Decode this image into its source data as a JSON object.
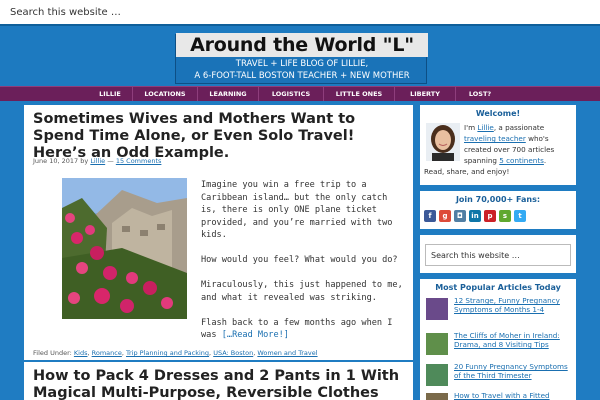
{
  "search": {
    "placeholder": "Search this website …"
  },
  "header": {
    "logo_title": "Around the World \"L\"",
    "tagline_1": "TRAVEL + LIFE BLOG OF LILLIE,",
    "tagline_2": "A 6-FOOT-TALL BOSTON TEACHER + NEW MOTHER"
  },
  "nav": {
    "items": [
      "LILLIE",
      "LOCATIONS",
      "LEARNING",
      "LOGISTICS",
      "LITTLE ONES",
      "LIBERTY",
      "LOST?"
    ]
  },
  "post": {
    "title": "Sometimes Wives and Mothers Want to Spend Time Alone, or Even Solo Travel! Here’s an Odd Example.",
    "date": "June 10, 2017",
    "by": "by",
    "author": "Lillie",
    "dash": "—",
    "comments": "15 Comments",
    "paragraphs": [
      "Imagine you win a free trip to a Caribbean island… but the only catch is, there is only ONE plane ticket provided, and you’re married with two kids.",
      "How would you feel? What would you do?",
      "Miraculously, this just happened to me, and what it revealed was striking.",
      "Flash back to a few months ago when I was"
    ],
    "read_more": "[…Read More!]",
    "filed_under_label": "Filed Under:",
    "categories": [
      "Kids",
      "Romance",
      "Trip Planning and Packing",
      "USA: Boston",
      "Women and Travel"
    ]
  },
  "post2": {
    "title": "How to Pack 4 Dresses and 2 Pants in 1 With Magical Multi-Purpose, Reversible Clothes"
  },
  "sidebar": {
    "welcome": {
      "heading": "Welcome!",
      "t1": "I'm ",
      "name": "Lillie",
      "t2": ", a passionate",
      "teacher": "traveling teacher",
      "t3": " who's",
      "t4": "created over 700 articles",
      "t5": "spanning ",
      "continents": "5 continents",
      "t6": ".",
      "t7": "Read, share, and enjoy!"
    },
    "fans": {
      "heading": "Join 70,000+ Fans:",
      "icons": [
        "facebook-icon",
        "google-plus-icon",
        "instagram-icon",
        "linkedin-icon",
        "pinterest-icon",
        "stumbleupon-icon",
        "twitter-icon"
      ]
    },
    "search_placeholder": "Search this website …",
    "popular": {
      "heading": "Most Popular Articles Today",
      "items": [
        "12 Strange, Funny Pregnancy Symptoms of Months 1-4",
        "The Cliffs of Moher in Ireland: Drama, and 8 Visiting Tips",
        "20 Funny Pregnancy Symptoms of the Third Trimester",
        "How to Travel with a Fitted"
      ]
    }
  },
  "colors": {
    "background": "#1f7cc2",
    "nav": "#6b1f5a",
    "link": "#1a6fb0"
  }
}
